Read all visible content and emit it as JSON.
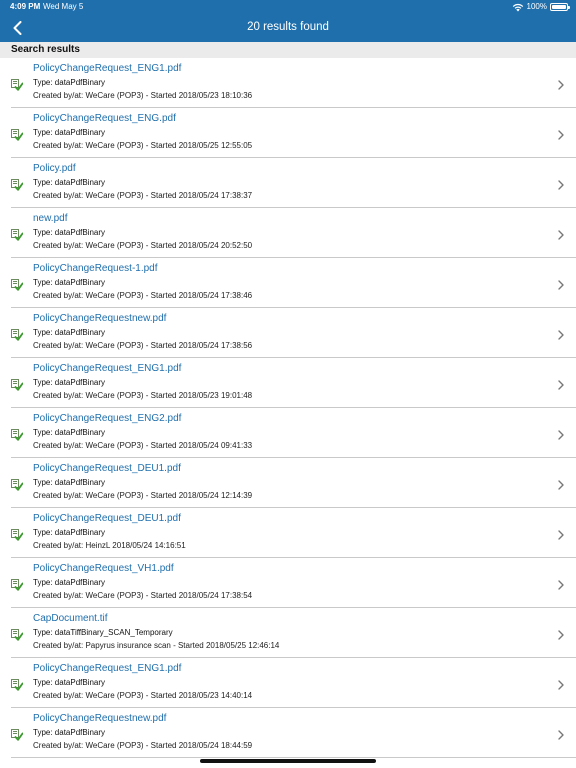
{
  "status_bar": {
    "time": "4:09 PM",
    "date": "Wed May 5",
    "battery_text": "100%",
    "battery_level": 1.0
  },
  "nav": {
    "title": "20 results found"
  },
  "section_header": "Search results",
  "colors": {
    "accent": "#1f6fad",
    "icon_green": "#3a9a2e"
  },
  "results": [
    {
      "title": "PolicyChangeRequest_ENG1.pdf",
      "type": "Type: dataPdfBinary",
      "created": "Created by/at: WeCare (POP3) - Started 2018/05/23 18:10:36"
    },
    {
      "title": "PolicyChangeRequest_ENG.pdf",
      "type": "Type: dataPdfBinary",
      "created": "Created by/at: WeCare (POP3) - Started 2018/05/25 12:55:05"
    },
    {
      "title": "Policy.pdf",
      "type": "Type: dataPdfBinary",
      "created": "Created by/at: WeCare (POP3) - Started 2018/05/24 17:38:37"
    },
    {
      "title": "new.pdf",
      "type": "Type: dataPdfBinary",
      "created": "Created by/at: WeCare (POP3) - Started 2018/05/24 20:52:50"
    },
    {
      "title": "PolicyChangeRequest-1.pdf",
      "type": "Type: dataPdfBinary",
      "created": "Created by/at: WeCare (POP3) - Started 2018/05/24 17:38:46"
    },
    {
      "title": "PolicyChangeRequestnew.pdf",
      "type": "Type: dataPdfBinary",
      "created": "Created by/at: WeCare (POP3) - Started 2018/05/24 17:38:56"
    },
    {
      "title": "PolicyChangeRequest_ENG1.pdf",
      "type": "Type: dataPdfBinary",
      "created": "Created by/at: WeCare (POP3) - Started 2018/05/23 19:01:48"
    },
    {
      "title": "PolicyChangeRequest_ENG2.pdf",
      "type": "Type: dataPdfBinary",
      "created": "Created by/at: WeCare (POP3) - Started 2018/05/24 09:41:33"
    },
    {
      "title": "PolicyChangeRequest_DEU1.pdf",
      "type": "Type: dataPdfBinary",
      "created": "Created by/at: WeCare (POP3) - Started 2018/05/24 12:14:39"
    },
    {
      "title": "PolicyChangeRequest_DEU1.pdf",
      "type": "Type: dataPdfBinary",
      "created": "Created by/at: HeinzL 2018/05/24 14:16:51"
    },
    {
      "title": "PolicyChangeRequest_VH1.pdf",
      "type": "Type: dataPdfBinary",
      "created": "Created by/at: WeCare (POP3) - Started 2018/05/24 17:38:54"
    },
    {
      "title": "CapDocument.tif",
      "type": "Type: dataTiffBinary_SCAN_Temporary",
      "created": "Created by/at: Papyrus insurance scan - Started 2018/05/25 12:46:14"
    },
    {
      "title": "PolicyChangeRequest_ENG1.pdf",
      "type": "Type: dataPdfBinary",
      "created": "Created by/at: WeCare (POP3) - Started 2018/05/23 14:40:14"
    },
    {
      "title": "PolicyChangeRequestnew.pdf",
      "type": "Type: dataPdfBinary",
      "created": "Created by/at: WeCare (POP3) - Started 2018/05/24 18:44:59"
    }
  ]
}
